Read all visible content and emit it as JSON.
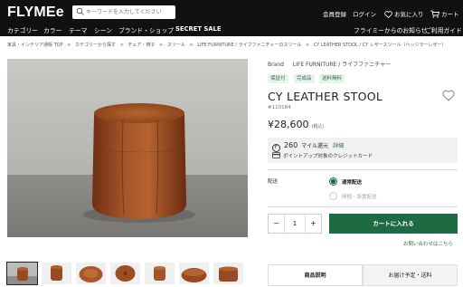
{
  "header": {
    "logo": "FLYMEe",
    "search_placeholder": "キーワードを入力してください",
    "links": {
      "register": "会員登録",
      "login": "ログイン",
      "favorites": "お気に入り",
      "cart": "カート"
    },
    "nav": [
      "カテゴリー",
      "カラー",
      "テーマ",
      "シーン",
      "ブランド・ショップ"
    ],
    "nav_sale": "SECRET SALE",
    "right_links": {
      "prime": "フライミーからのお知らせ",
      "guide": "ご利用ガイド"
    }
  },
  "breadcrumb": [
    "家具・インテリア通販 TOP",
    ">",
    "カテゴリーから探す",
    ">",
    "チェア・椅子",
    ">",
    "スツール",
    ">",
    "LIFE FURNITURE / ライフファニチャーのスツール",
    ">",
    "CY LEATHER STOOL / CY レザースツール（ヘッジラーレザー）"
  ],
  "product": {
    "brand_label": "Brand",
    "brand_name": "LIFE FURNITURE / ライフファニチャー",
    "tags": [
      "保証付",
      "完成品",
      "送料無料"
    ],
    "title": "CY LEATHER STOOL",
    "sku": "#110184",
    "price": "¥28,600",
    "price_tax": "(税込)",
    "points_icon": "F",
    "points_value": "260",
    "points_unit": "マイル還元",
    "points_detail": "詳細",
    "points_note": "ポイントアップ対象のクレジットカード",
    "delivery_label": "配送",
    "delivery_options": [
      {
        "label": "通常配送",
        "selected": true
      },
      {
        "label": "開梱・設置配送",
        "selected": false
      }
    ],
    "quantity": "1",
    "minus": "−",
    "plus": "+",
    "cart_button": "カートに入れる",
    "inquiry": "お問い合わせはこちら",
    "tabs": [
      "商品説明",
      "お届け予定・送料"
    ]
  },
  "colors": {
    "accent": "#1e6a43",
    "header_bg": "#111111",
    "leather": "#9a4a22"
  }
}
